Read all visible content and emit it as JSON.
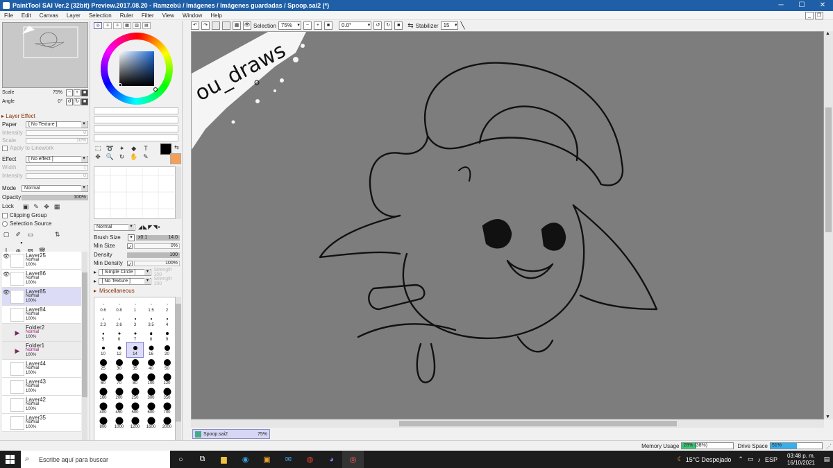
{
  "window": {
    "title": "PaintTool SAI Ver.2 (32bit) Preview.2017.08.20 - Ramzebú / Imágenes / Imágenes guardadas / Spoop.sai2 (*)",
    "min": "─",
    "max": "☐",
    "close": "✕"
  },
  "menu": [
    "File",
    "Edit",
    "Canvas",
    "Layer",
    "Selection",
    "Ruler",
    "Filter",
    "View",
    "Window",
    "Help"
  ],
  "navigator": {
    "scale_label": "Scale",
    "scale_value": "75%",
    "angle_label": "Angle",
    "angle_value": "0°"
  },
  "layer_effect": {
    "header": "Layer Effect",
    "paper_label": "Paper",
    "paper_value": "[ No Texture ]",
    "intensity_label": "Intensity",
    "intensity_value": "0",
    "scale_label": "Scale",
    "scale_value": "10%",
    "apply_label": "Apply to Linework",
    "effect_label": "Effect",
    "effect_value": "[ No effect ]",
    "width_label": "Width",
    "width_value": "1",
    "intensity2_label": "Intensity",
    "intensity2_value": "0"
  },
  "layer_props": {
    "mode_label": "Mode",
    "mode_value": "Normal",
    "opacity_label": "Opacity",
    "opacity_value": "100%",
    "lock_label": "Lock",
    "clipping_label": "Clipping Group",
    "selection_source_label": "Selection Source"
  },
  "layers": [
    {
      "name": "Layer25",
      "mode": "Normal",
      "opacity": "100%",
      "visible": true,
      "selected": false,
      "folder": false
    },
    {
      "name": "Layer86",
      "mode": "Normal",
      "opacity": "100%",
      "visible": true,
      "selected": false,
      "folder": false
    },
    {
      "name": "Layer85",
      "mode": "Normal",
      "opacity": "100%",
      "visible": true,
      "selected": true,
      "folder": false
    },
    {
      "name": "Layer84",
      "mode": "Normal",
      "opacity": "100%",
      "visible": false,
      "selected": false,
      "folder": false
    },
    {
      "name": "Folder2",
      "mode": "Normal",
      "opacity": "100%",
      "visible": false,
      "selected": false,
      "folder": true
    },
    {
      "name": "Folder1",
      "mode": "Normal",
      "opacity": "100%",
      "visible": false,
      "selected": false,
      "folder": true
    },
    {
      "name": "Layer44",
      "mode": "Normal",
      "opacity": "100%",
      "visible": false,
      "selected": false,
      "folder": false
    },
    {
      "name": "Layer43",
      "mode": "Normal",
      "opacity": "100%",
      "visible": false,
      "selected": false,
      "folder": false
    },
    {
      "name": "Layer42",
      "mode": "Normal",
      "opacity": "100%",
      "visible": false,
      "selected": false,
      "folder": false
    },
    {
      "name": "Layer35",
      "mode": "Normal",
      "opacity": "100%",
      "visible": false,
      "selected": false,
      "folder": false
    }
  ],
  "colors": {
    "foreground": "#000000",
    "background": "#f5a05a",
    "title_bar": "#1f5fa8",
    "selected_row": "#dcdcf6"
  },
  "brush": {
    "blend_value": "Normal",
    "size_label": "Brush Size",
    "size_mult": "x0.1",
    "size_value": "14.0",
    "min_size_label": "Min Size",
    "min_size_value": "0%",
    "density_label": "Density",
    "density_value": "100",
    "min_density_label": "Min Density",
    "min_density_value": "100%",
    "shape_value": "[ Simple Circle ]",
    "shape_strength": "Strength 100",
    "texture_value": "[ No Texture ]",
    "texture_strength": "Strength 100",
    "misc_label": "Miscellaneous"
  },
  "brush_sizes": [
    {
      "label": "0.6",
      "d": 1
    },
    {
      "label": "0.8",
      "d": 1
    },
    {
      "label": "1",
      "d": 1
    },
    {
      "label": "1.5",
      "d": 1
    },
    {
      "label": "2",
      "d": 1
    },
    {
      "label": "2.3",
      "d": 1.5
    },
    {
      "label": "2.6",
      "d": 1.5
    },
    {
      "label": "3",
      "d": 2
    },
    {
      "label": "3.5",
      "d": 2
    },
    {
      "label": "4",
      "d": 2
    },
    {
      "label": "5",
      "d": 2.5
    },
    {
      "label": "6",
      "d": 3
    },
    {
      "label": "7",
      "d": 3
    },
    {
      "label": "8",
      "d": 3.5
    },
    {
      "label": "9",
      "d": 4
    },
    {
      "label": "10",
      "d": 4
    },
    {
      "label": "12",
      "d": 5
    },
    {
      "label": "14",
      "d": 6,
      "selected": true
    },
    {
      "label": "16",
      "d": 7
    },
    {
      "label": "20",
      "d": 8
    },
    {
      "label": "25",
      "d": 10
    },
    {
      "label": "30",
      "d": 10
    },
    {
      "label": "35",
      "d": 10
    },
    {
      "label": "40",
      "d": 10
    },
    {
      "label": "50",
      "d": 10
    },
    {
      "label": "60",
      "d": 11
    },
    {
      "label": "70",
      "d": 11
    },
    {
      "label": "80",
      "d": 11
    },
    {
      "label": "100",
      "d": 11
    },
    {
      "label": "120",
      "d": 11
    },
    {
      "label": "160",
      "d": 11
    },
    {
      "label": "200",
      "d": 11
    },
    {
      "label": "250",
      "d": 11
    },
    {
      "label": "300",
      "d": 11
    },
    {
      "label": "350",
      "d": 11
    },
    {
      "label": "400",
      "d": 11
    },
    {
      "label": "450",
      "d": 11
    },
    {
      "label": "500",
      "d": 11
    },
    {
      "label": "600",
      "d": 11
    },
    {
      "label": "700",
      "d": 11
    },
    {
      "label": "800",
      "d": 11
    },
    {
      "label": "1000",
      "d": 11
    },
    {
      "label": "1200",
      "d": 11
    },
    {
      "label": "1600",
      "d": 11
    },
    {
      "label": "2000",
      "d": 11
    }
  ],
  "canvas_toolbar": {
    "selection_label": "Selection",
    "zoom_value": "75%",
    "angle_value": "0.0°",
    "stabilizer_label": "Stabilizer",
    "stabilizer_value": "15"
  },
  "canvas": {
    "watermark": "ou_draws"
  },
  "doc_tab": {
    "name": "Spoop.sai2",
    "zoom": "75%"
  },
  "status": {
    "memory_label": "Memory Usage",
    "memory_text": "28% (38%)",
    "memory_fraction": 0.28,
    "drive_label": "Drive Space",
    "drive_text": "51%",
    "drive_fraction": 0.51
  },
  "taskbar": {
    "search_placeholder": "Escribe aquí para buscar",
    "weather": "15°C  Despejado",
    "language": "ESP",
    "time": "03:48 p. m.",
    "date": "16/10/2021"
  }
}
